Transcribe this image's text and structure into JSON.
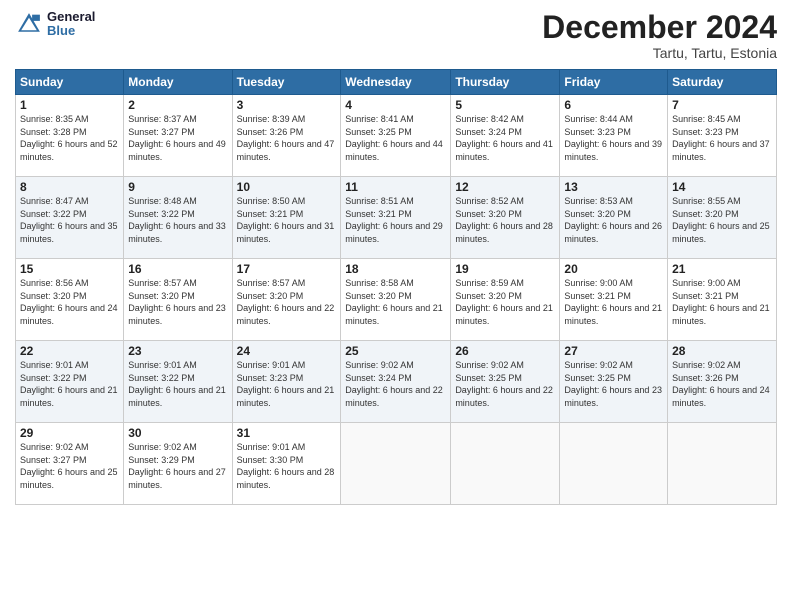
{
  "logo": {
    "line1": "General",
    "line2": "Blue"
  },
  "title": "December 2024",
  "subtitle": "Tartu, Tartu, Estonia",
  "days_header": [
    "Sunday",
    "Monday",
    "Tuesday",
    "Wednesday",
    "Thursday",
    "Friday",
    "Saturday"
  ],
  "weeks": [
    [
      {
        "day": "1",
        "sunrise": "Sunrise: 8:35 AM",
        "sunset": "Sunset: 3:28 PM",
        "daylight": "Daylight: 6 hours and 52 minutes."
      },
      {
        "day": "2",
        "sunrise": "Sunrise: 8:37 AM",
        "sunset": "Sunset: 3:27 PM",
        "daylight": "Daylight: 6 hours and 49 minutes."
      },
      {
        "day": "3",
        "sunrise": "Sunrise: 8:39 AM",
        "sunset": "Sunset: 3:26 PM",
        "daylight": "Daylight: 6 hours and 47 minutes."
      },
      {
        "day": "4",
        "sunrise": "Sunrise: 8:41 AM",
        "sunset": "Sunset: 3:25 PM",
        "daylight": "Daylight: 6 hours and 44 minutes."
      },
      {
        "day": "5",
        "sunrise": "Sunrise: 8:42 AM",
        "sunset": "Sunset: 3:24 PM",
        "daylight": "Daylight: 6 hours and 41 minutes."
      },
      {
        "day": "6",
        "sunrise": "Sunrise: 8:44 AM",
        "sunset": "Sunset: 3:23 PM",
        "daylight": "Daylight: 6 hours and 39 minutes."
      },
      {
        "day": "7",
        "sunrise": "Sunrise: 8:45 AM",
        "sunset": "Sunset: 3:23 PM",
        "daylight": "Daylight: 6 hours and 37 minutes."
      }
    ],
    [
      {
        "day": "8",
        "sunrise": "Sunrise: 8:47 AM",
        "sunset": "Sunset: 3:22 PM",
        "daylight": "Daylight: 6 hours and 35 minutes."
      },
      {
        "day": "9",
        "sunrise": "Sunrise: 8:48 AM",
        "sunset": "Sunset: 3:22 PM",
        "daylight": "Daylight: 6 hours and 33 minutes."
      },
      {
        "day": "10",
        "sunrise": "Sunrise: 8:50 AM",
        "sunset": "Sunset: 3:21 PM",
        "daylight": "Daylight: 6 hours and 31 minutes."
      },
      {
        "day": "11",
        "sunrise": "Sunrise: 8:51 AM",
        "sunset": "Sunset: 3:21 PM",
        "daylight": "Daylight: 6 hours and 29 minutes."
      },
      {
        "day": "12",
        "sunrise": "Sunrise: 8:52 AM",
        "sunset": "Sunset: 3:20 PM",
        "daylight": "Daylight: 6 hours and 28 minutes."
      },
      {
        "day": "13",
        "sunrise": "Sunrise: 8:53 AM",
        "sunset": "Sunset: 3:20 PM",
        "daylight": "Daylight: 6 hours and 26 minutes."
      },
      {
        "day": "14",
        "sunrise": "Sunrise: 8:55 AM",
        "sunset": "Sunset: 3:20 PM",
        "daylight": "Daylight: 6 hours and 25 minutes."
      }
    ],
    [
      {
        "day": "15",
        "sunrise": "Sunrise: 8:56 AM",
        "sunset": "Sunset: 3:20 PM",
        "daylight": "Daylight: 6 hours and 24 minutes."
      },
      {
        "day": "16",
        "sunrise": "Sunrise: 8:57 AM",
        "sunset": "Sunset: 3:20 PM",
        "daylight": "Daylight: 6 hours and 23 minutes."
      },
      {
        "day": "17",
        "sunrise": "Sunrise: 8:57 AM",
        "sunset": "Sunset: 3:20 PM",
        "daylight": "Daylight: 6 hours and 22 minutes."
      },
      {
        "day": "18",
        "sunrise": "Sunrise: 8:58 AM",
        "sunset": "Sunset: 3:20 PM",
        "daylight": "Daylight: 6 hours and 21 minutes."
      },
      {
        "day": "19",
        "sunrise": "Sunrise: 8:59 AM",
        "sunset": "Sunset: 3:20 PM",
        "daylight": "Daylight: 6 hours and 21 minutes."
      },
      {
        "day": "20",
        "sunrise": "Sunrise: 9:00 AM",
        "sunset": "Sunset: 3:21 PM",
        "daylight": "Daylight: 6 hours and 21 minutes."
      },
      {
        "day": "21",
        "sunrise": "Sunrise: 9:00 AM",
        "sunset": "Sunset: 3:21 PM",
        "daylight": "Daylight: 6 hours and 21 minutes."
      }
    ],
    [
      {
        "day": "22",
        "sunrise": "Sunrise: 9:01 AM",
        "sunset": "Sunset: 3:22 PM",
        "daylight": "Daylight: 6 hours and 21 minutes."
      },
      {
        "day": "23",
        "sunrise": "Sunrise: 9:01 AM",
        "sunset": "Sunset: 3:22 PM",
        "daylight": "Daylight: 6 hours and 21 minutes."
      },
      {
        "day": "24",
        "sunrise": "Sunrise: 9:01 AM",
        "sunset": "Sunset: 3:23 PM",
        "daylight": "Daylight: 6 hours and 21 minutes."
      },
      {
        "day": "25",
        "sunrise": "Sunrise: 9:02 AM",
        "sunset": "Sunset: 3:24 PM",
        "daylight": "Daylight: 6 hours and 22 minutes."
      },
      {
        "day": "26",
        "sunrise": "Sunrise: 9:02 AM",
        "sunset": "Sunset: 3:25 PM",
        "daylight": "Daylight: 6 hours and 22 minutes."
      },
      {
        "day": "27",
        "sunrise": "Sunrise: 9:02 AM",
        "sunset": "Sunset: 3:25 PM",
        "daylight": "Daylight: 6 hours and 23 minutes."
      },
      {
        "day": "28",
        "sunrise": "Sunrise: 9:02 AM",
        "sunset": "Sunset: 3:26 PM",
        "daylight": "Daylight: 6 hours and 24 minutes."
      }
    ],
    [
      {
        "day": "29",
        "sunrise": "Sunrise: 9:02 AM",
        "sunset": "Sunset: 3:27 PM",
        "daylight": "Daylight: 6 hours and 25 minutes."
      },
      {
        "day": "30",
        "sunrise": "Sunrise: 9:02 AM",
        "sunset": "Sunset: 3:29 PM",
        "daylight": "Daylight: 6 hours and 27 minutes."
      },
      {
        "day": "31",
        "sunrise": "Sunrise: 9:01 AM",
        "sunset": "Sunset: 3:30 PM",
        "daylight": "Daylight: 6 hours and 28 minutes."
      },
      null,
      null,
      null,
      null
    ]
  ]
}
